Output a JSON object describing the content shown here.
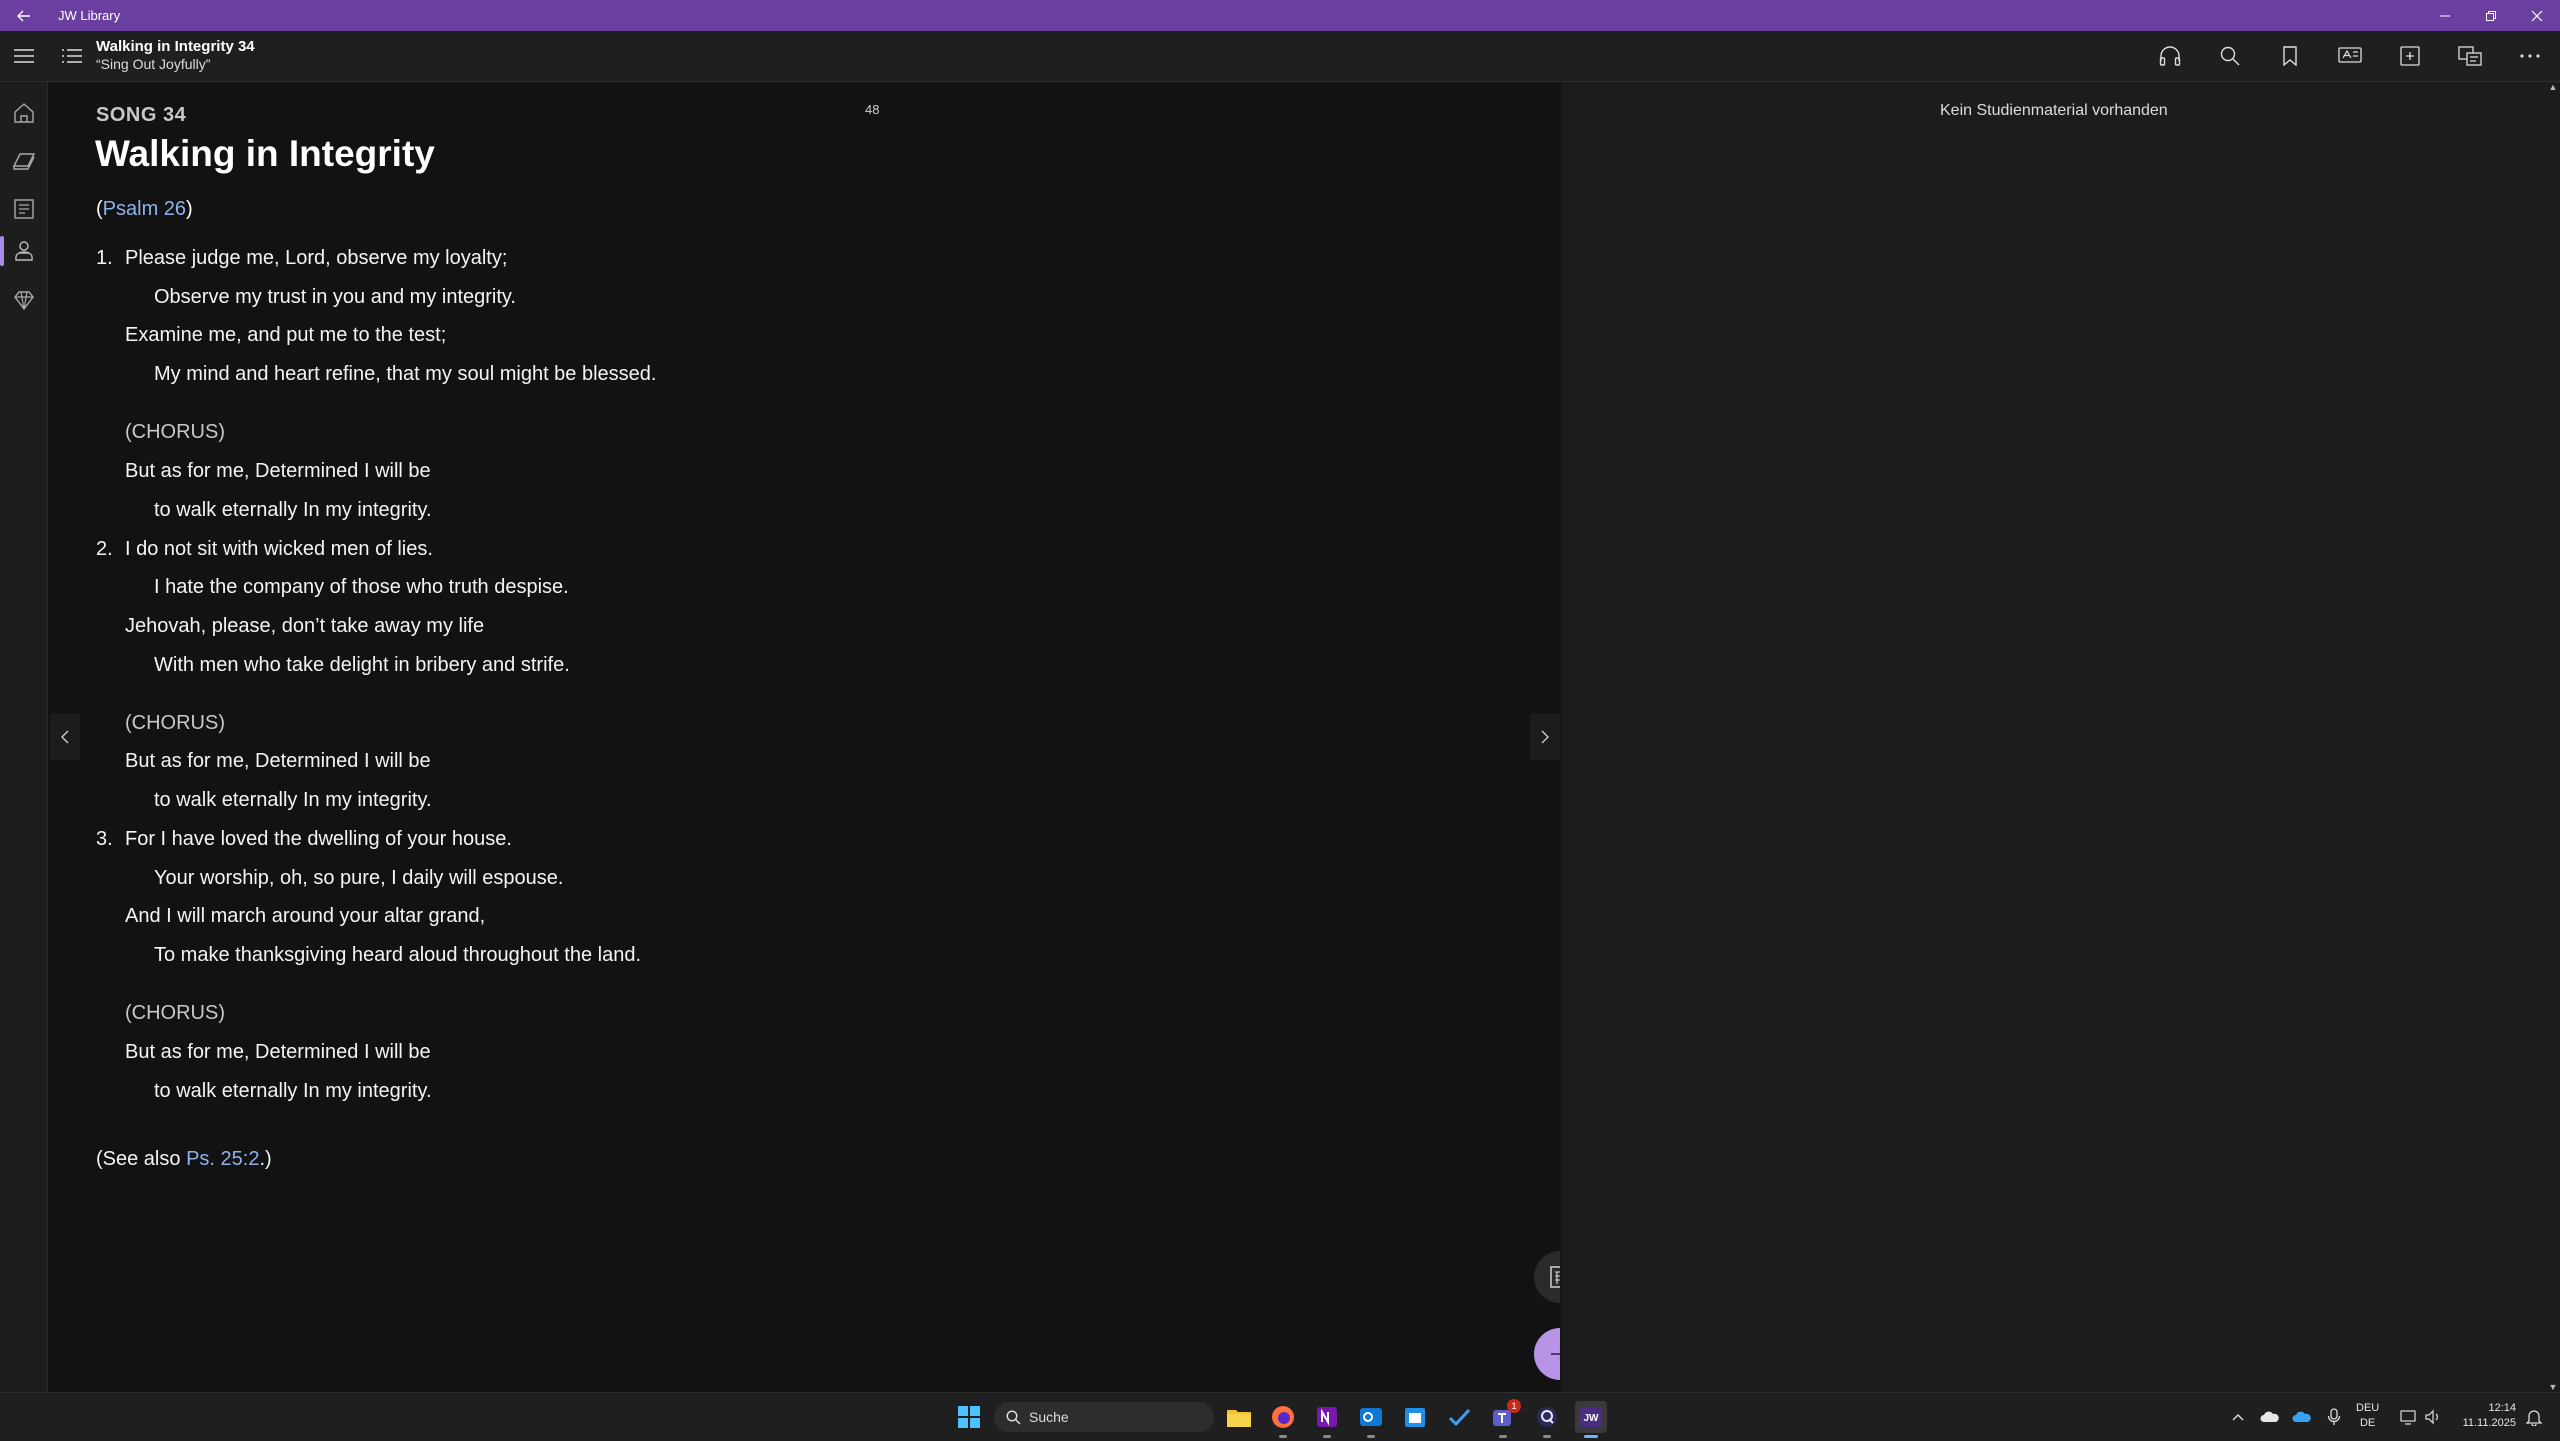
{
  "window": {
    "title": "JW Library"
  },
  "header": {
    "doc_title": "Walking in Integrity 34",
    "doc_subtitle": "“Sing Out Joyfully”",
    "actions": [
      "headphones-icon",
      "search-icon",
      "bookmark-icon",
      "study-icon",
      "add-note-icon",
      "translate-icon",
      "more-icon"
    ]
  },
  "rail": {
    "items": [
      "home-icon",
      "bible-icon",
      "publications-icon",
      "meetings-icon",
      "personal-study-icon"
    ],
    "active_index": 3
  },
  "document": {
    "page_number": "48",
    "song_label": "SONG 34",
    "title": "Walking in Integrity",
    "ref_open": "(",
    "ref_link": "Psalm 26",
    "ref_close": ")",
    "verses": [
      {
        "number": "1.",
        "lines": [
          "Please judge me, Lord, observe my loyalty;",
          "Observe my trust in you and my integrity.",
          "Examine me, and put me to the test;",
          "My mind and heart refine, that my soul might be blessed."
        ]
      },
      {
        "number": "2.",
        "lines": [
          "I do not sit with wicked men of lies.",
          "I hate the company of those who truth despise.",
          "Jehovah, please, don’t take away my life",
          "With men who take delight in bribery and strife."
        ]
      },
      {
        "number": "3.",
        "lines": [
          "For I have loved the dwelling of your house.",
          "Your worship, oh, so pure, I daily will espouse.",
          "And I will march around your altar grand,",
          "To make thanksgiving heard aloud throughout the land."
        ]
      }
    ],
    "chorus": {
      "label": "(CHORUS)",
      "lines": [
        "But as for me, Determined I will be",
        "to walk eternally In my integrity."
      ]
    },
    "see_also_prefix": "(See also ",
    "see_also_link": "Ps. 25:2",
    "see_also_suffix": ".)"
  },
  "side_panel": {
    "message": "Kein Studienmaterial vorhanden"
  },
  "taskbar": {
    "search_placeholder": "Suche",
    "language_top": "DEU",
    "language_bottom": "DE",
    "time": "12:14",
    "date": "11.11.2025",
    "teams_badge": "1"
  },
  "colors": {
    "accent": "#6b3fa0",
    "link": "#8fb2ef",
    "float_button": "#b893e6"
  }
}
